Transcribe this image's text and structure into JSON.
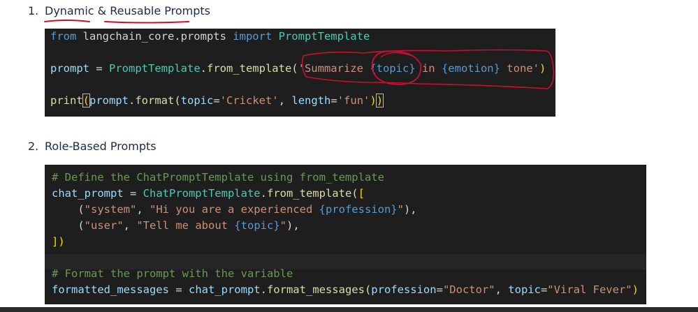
{
  "sections": [
    {
      "number": "1.",
      "title": "Dynamic & Reusable Prompts"
    },
    {
      "number": "2.",
      "title": "Role-Based Prompts"
    }
  ],
  "code1": {
    "line1": {
      "from": "from",
      "module": " langchain_core.prompts ",
      "import": "import",
      "name": " PromptTemplate"
    },
    "line2": {
      "var": "prompt",
      "eq": " = ",
      "cls": "PromptTemplate",
      "method": ".from_template(",
      "s1": "'Summarize ",
      "p1": "{topic}",
      "s2": " in ",
      "p2": "{emotion}",
      "s3": " tone'",
      "close": ")"
    },
    "line3": {
      "fn": "print",
      "open": "(",
      "obj": "prompt",
      "method": ".format(",
      "k1": "topic",
      "v1": "'Cricket'",
      "sep": ", ",
      "k2": "length",
      "v2": "'fun'",
      "close1": ")",
      "close2": ")"
    }
  },
  "code2": {
    "comment1": "# Define the ChatPromptTemplate using from_template",
    "line2": {
      "var": "chat_prompt",
      "eq": " = ",
      "cls": "ChatPromptTemplate",
      "method": ".from_template(",
      "bracket": "["
    },
    "line3": {
      "indent": "    (",
      "role": "\"system\"",
      "sep": ", ",
      "s1": "\"Hi you are a experienced ",
      "p": "{profession}",
      "s2": "\"",
      "end": "),"
    },
    "line4": {
      "indent": "    (",
      "role": "\"user\"",
      "sep": ", ",
      "s1": "\"Tell me about ",
      "p": "{topic}",
      "s2": "\"",
      "end": "),"
    },
    "line5": {
      "bracket": "]",
      "paren": ")"
    },
    "comment2": "# Format the prompt with the variable",
    "line8": {
      "var": "formatted_messages",
      "eq": " = ",
      "obj": "chat_prompt",
      "method": ".format_messages(",
      "k1": "profession",
      "v1": "\"Doctor\"",
      "sep": ", ",
      "k2": "topic",
      "v2": "\"Viral Fever\"",
      "close": ")"
    }
  },
  "colors": {
    "code_background": "#1e1e1e",
    "annotation_red": "#c8102e",
    "heading_text": "#1f2a44"
  }
}
